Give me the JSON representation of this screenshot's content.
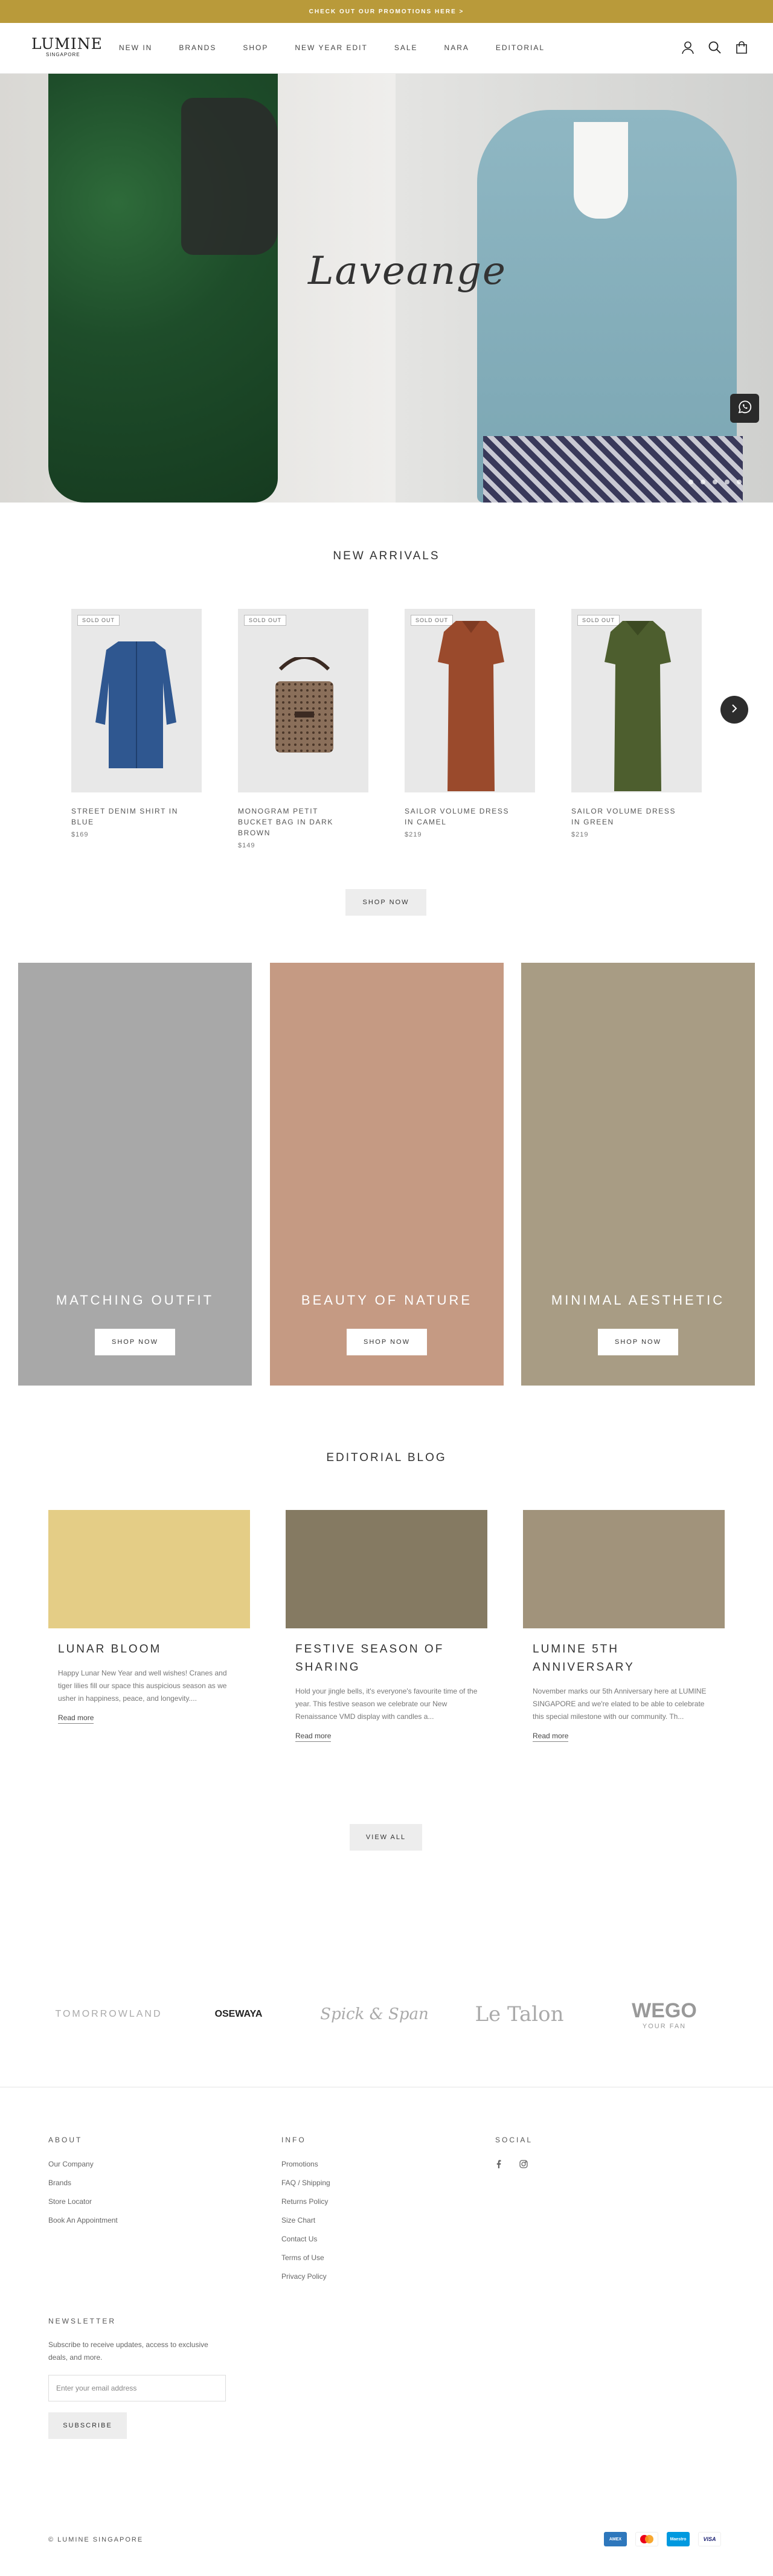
{
  "promo_bar": {
    "text": "CHECK OUT OUR PROMOTIONS HERE >"
  },
  "header": {
    "logo": {
      "line1": "LUMINE",
      "line2": "SINGAPORE"
    },
    "nav": [
      "NEW IN",
      "BRANDS",
      "SHOP",
      "NEW YEAR EDIT",
      "SALE",
      "NARA",
      "EDITORIAL"
    ],
    "icons": [
      "account-icon",
      "search-icon",
      "cart-icon"
    ]
  },
  "hero": {
    "script_text": "Laveange",
    "slides": 5,
    "active_slide": 1
  },
  "new_arrivals": {
    "title": "NEW ARRIVALS",
    "products": [
      {
        "badge": "SOLD OUT",
        "name": "STREET DENIM SHIRT IN BLUE",
        "price": "$169",
        "color": "#2f5790"
      },
      {
        "badge": "SOLD OUT",
        "name": "MONOGRAM PETIT BUCKET BAG IN DARK BROWN",
        "price": "$149",
        "color": "#8a6f5a"
      },
      {
        "badge": "SOLD OUT",
        "name": "SAILOR VOLUME DRESS IN CAMEL",
        "price": "$219",
        "color": "#9a4a2c"
      },
      {
        "badge": "SOLD OUT",
        "name": "SAILOR VOLUME DRESS IN GREEN",
        "price": "$219",
        "color": "#4d5e2e"
      }
    ],
    "button": "SHOP NOW"
  },
  "collections": [
    {
      "title": "MATCHING OUTFIT",
      "button": "SHOP NOW",
      "color": "#a8a8a8"
    },
    {
      "title": "BEAUTY OF NATURE",
      "button": "SHOP NOW",
      "color": "#c59a83"
    },
    {
      "title": "MINIMAL AESTHETIC",
      "button": "SHOP NOW",
      "color": "#a89c84"
    }
  ],
  "blog": {
    "title": "EDITORIAL BLOG",
    "posts": [
      {
        "title": "LUNAR BLOOM",
        "excerpt": "Happy Lunar New Year and well wishes! Cranes and tiger lilies fill our space this auspicious season as we usher in happiness, peace, and longevity....",
        "more": "Read more",
        "color": "#e4cd86"
      },
      {
        "title": "FESTIVE SEASON OF SHARING",
        "excerpt": "Hold your jingle bells, it's everyone's favourite time of the year. This festive season we celebrate our New Renaissance VMD display with candles a...",
        "more": "Read more",
        "color": "#857a62"
      },
      {
        "title": "LUMINE 5TH ANNIVERSARY",
        "excerpt": "November marks our 5th Anniversary here at LUMINE SINGAPORE and we're elated to be able to celebrate this special milestone with our community. Th...",
        "more": "Read more",
        "color": "#a1937b"
      }
    ],
    "button": "VIEW ALL"
  },
  "brands": [
    "TOMORROWLAND",
    "OSEWAYA",
    "Spick & Span",
    "Le Talon",
    "WEGO",
    "YOUR FAN"
  ],
  "footer": {
    "about": {
      "heading": "ABOUT",
      "links": [
        "Our Company",
        "Brands",
        "Store Locator",
        "Book An Appointment"
      ]
    },
    "info": {
      "heading": "INFO",
      "links": [
        "Promotions",
        "FAQ / Shipping",
        "Returns Policy",
        "Size Chart",
        "Contact Us",
        "Terms of Use",
        "Privacy Policy"
      ]
    },
    "social": {
      "heading": "SOCIAL",
      "icons": [
        "facebook-icon",
        "instagram-icon"
      ]
    },
    "newsletter": {
      "heading": "NEWSLETTER",
      "text": "Subscribe to receive updates, access to exclusive deals, and more.",
      "placeholder": "Enter your email address",
      "button": "SUBSCRIBE"
    },
    "copyright": "© LUMINE SINGAPORE",
    "payments": [
      "AMEX",
      "Mastercard",
      "Maestro",
      "VISA"
    ]
  }
}
